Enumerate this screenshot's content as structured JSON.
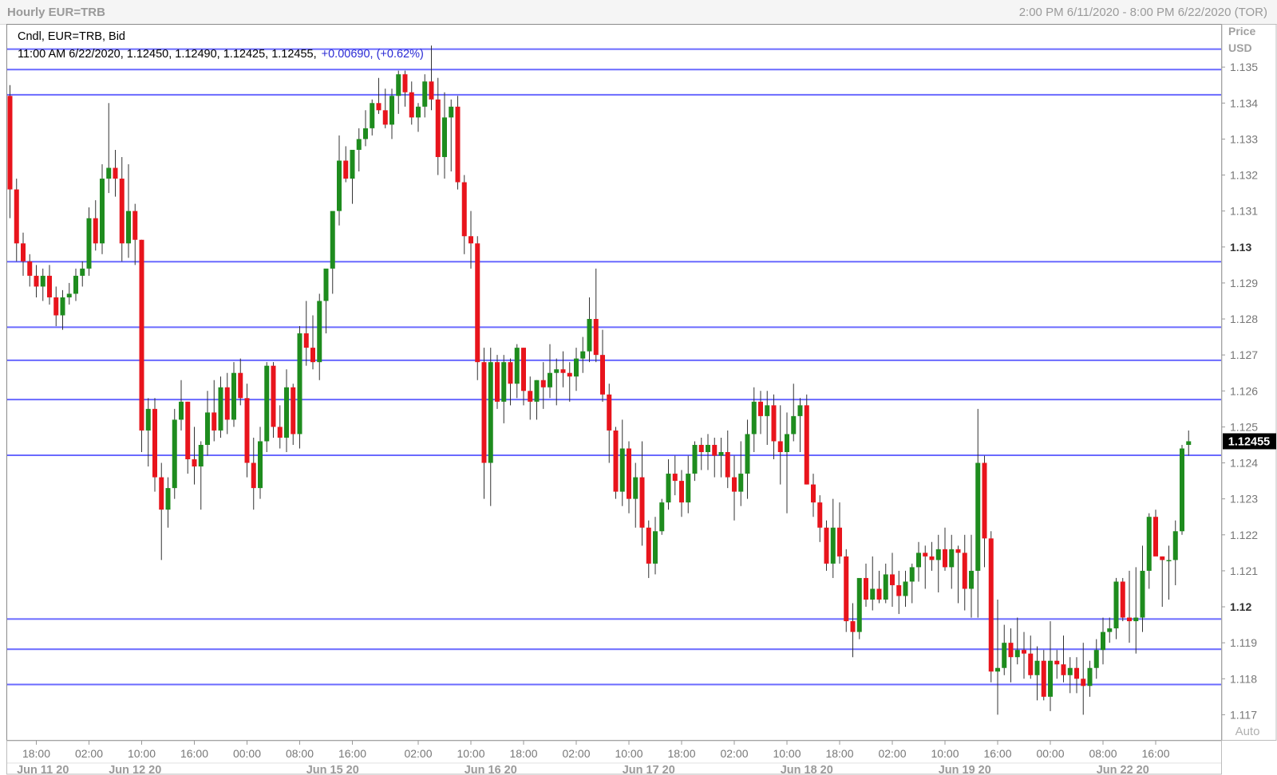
{
  "window": {
    "title": "Hourly EUR=TRB",
    "range": "2:00 PM 6/11/2020 - 8:00 PM 6/22/2020 (TOR)"
  },
  "legend": {
    "line1": "Cndl, EUR=TRB, Bid",
    "ohlc": "11:00 AM 6/22/2020, 1.12450, 1.12490, 1.12425, 1.12455,",
    "change": "+0.00690, (+0.62%)"
  },
  "price_axis": {
    "title_line1": "Price",
    "title_line2": "USD",
    "last_price_label": "1.12455",
    "auto_label": "Auto"
  },
  "colors": {
    "up": "#1e8c1e",
    "down": "#e8141c",
    "hline": "#6a6aff",
    "change_text": "#2b2bd4",
    "last_price_bg": "#000000"
  },
  "chart_data": {
    "type": "candlestick",
    "symbol": "EUR=TRB",
    "interval": "Hourly",
    "ylim": [
      1.1163,
      1.1362
    ],
    "y_ticks": [
      {
        "v": 1.135,
        "label": "1.135"
      },
      {
        "v": 1.134,
        "label": "1.134"
      },
      {
        "v": 1.133,
        "label": "1.133"
      },
      {
        "v": 1.132,
        "label": "1.132"
      },
      {
        "v": 1.131,
        "label": "1.131"
      },
      {
        "v": 1.13,
        "label": "1.13",
        "bold": true
      },
      {
        "v": 1.129,
        "label": "1.129"
      },
      {
        "v": 1.128,
        "label": "1.128"
      },
      {
        "v": 1.127,
        "label": "1.127"
      },
      {
        "v": 1.126,
        "label": "1.126"
      },
      {
        "v": 1.125,
        "label": "1.125"
      },
      {
        "v": 1.124,
        "label": "1.124"
      },
      {
        "v": 1.123,
        "label": "1.123"
      },
      {
        "v": 1.122,
        "label": "1.122"
      },
      {
        "v": 1.121,
        "label": "1.121"
      },
      {
        "v": 1.12,
        "label": "1.12",
        "bold": true
      },
      {
        "v": 1.119,
        "label": "1.119"
      },
      {
        "v": 1.118,
        "label": "1.118"
      },
      {
        "v": 1.117,
        "label": "1.117"
      }
    ],
    "x_ticks": [
      {
        "i": 4,
        "label": "18:00"
      },
      {
        "i": 12,
        "label": "02:00"
      },
      {
        "i": 20,
        "label": "10:00"
      },
      {
        "i": 28,
        "label": "16:00"
      },
      {
        "i": 36,
        "label": "00:00"
      },
      {
        "i": 44,
        "label": "08:00"
      },
      {
        "i": 52,
        "label": "16:00"
      },
      {
        "i": 62,
        "label": "02:00"
      },
      {
        "i": 70,
        "label": "10:00"
      },
      {
        "i": 78,
        "label": "18:00"
      },
      {
        "i": 86,
        "label": "02:00"
      },
      {
        "i": 94,
        "label": "10:00"
      },
      {
        "i": 102,
        "label": "18:00"
      },
      {
        "i": 110,
        "label": "02:00"
      },
      {
        "i": 118,
        "label": "10:00"
      },
      {
        "i": 126,
        "label": "18:00"
      },
      {
        "i": 134,
        "label": "02:00"
      },
      {
        "i": 142,
        "label": "10:00"
      },
      {
        "i": 150,
        "label": "16:00"
      },
      {
        "i": 158,
        "label": "00:00"
      },
      {
        "i": 166,
        "label": "08:00"
      },
      {
        "i": 174,
        "label": "16:00"
      }
    ],
    "date_labels": [
      {
        "i": 5,
        "label": "Jun 11 20"
      },
      {
        "i": 19,
        "label": "Jun 12 20"
      },
      {
        "i": 49,
        "label": "Jun 15 20"
      },
      {
        "i": 73,
        "label": "Jun 16 20"
      },
      {
        "i": 97,
        "label": "Jun 17 20"
      },
      {
        "i": 121,
        "label": "Jun 18 20"
      },
      {
        "i": 145,
        "label": "Jun 19 20"
      },
      {
        "i": 169,
        "label": "Jun 22 20"
      }
    ],
    "hlines": [
      1.1355,
      1.13493,
      1.13423,
      1.12959,
      1.12777,
      1.12685,
      1.12576,
      1.12421,
      1.11966,
      1.11882,
      1.11784
    ],
    "candles": [
      [
        1.1342,
        1.1345,
        1.1308,
        1.1316
      ],
      [
        1.1316,
        1.1319,
        1.1296,
        1.1301
      ],
      [
        1.1301,
        1.1304,
        1.1292,
        1.1296
      ],
      [
        1.1296,
        1.1298,
        1.1289,
        1.1292
      ],
      [
        1.1292,
        1.1295,
        1.1286,
        1.1289
      ],
      [
        1.1289,
        1.1294,
        1.1285,
        1.1292
      ],
      [
        1.1292,
        1.1295,
        1.1284,
        1.1286
      ],
      [
        1.1286,
        1.1289,
        1.1278,
        1.1281
      ],
      [
        1.1281,
        1.1288,
        1.1277,
        1.1286
      ],
      [
        1.1286,
        1.129,
        1.1284,
        1.1287
      ],
      [
        1.1287,
        1.1294,
        1.1285,
        1.1292
      ],
      [
        1.1292,
        1.1296,
        1.1289,
        1.1294
      ],
      [
        1.1294,
        1.1311,
        1.1292,
        1.1308
      ],
      [
        1.1308,
        1.1313,
        1.1299,
        1.1301
      ],
      [
        1.1301,
        1.1323,
        1.1298,
        1.1319
      ],
      [
        1.1319,
        1.134,
        1.1315,
        1.1322
      ],
      [
        1.1322,
        1.1327,
        1.1314,
        1.1319
      ],
      [
        1.1319,
        1.1325,
        1.1296,
        1.1301
      ],
      [
        1.1301,
        1.1323,
        1.1297,
        1.131
      ],
      [
        1.131,
        1.1312,
        1.1295,
        1.1302
      ],
      [
        1.1302,
        1.1302,
        1.1243,
        1.1249
      ],
      [
        1.1249,
        1.1258,
        1.1239,
        1.1255
      ],
      [
        1.1255,
        1.1258,
        1.1232,
        1.1236
      ],
      [
        1.1236,
        1.124,
        1.1213,
        1.1227
      ],
      [
        1.1227,
        1.1236,
        1.1222,
        1.1233
      ],
      [
        1.1233,
        1.1255,
        1.123,
        1.1252
      ],
      [
        1.1252,
        1.1263,
        1.1249,
        1.1257
      ],
      [
        1.1257,
        1.1257,
        1.1237,
        1.1241
      ],
      [
        1.1241,
        1.125,
        1.1234,
        1.1239
      ],
      [
        1.1239,
        1.1246,
        1.1227,
        1.1245
      ],
      [
        1.1245,
        1.126,
        1.1242,
        1.1254
      ],
      [
        1.1254,
        1.1263,
        1.1246,
        1.1249
      ],
      [
        1.1249,
        1.1264,
        1.1247,
        1.1261
      ],
      [
        1.1261,
        1.1265,
        1.1248,
        1.1252
      ],
      [
        1.1252,
        1.1268,
        1.125,
        1.1265
      ],
      [
        1.1265,
        1.1269,
        1.1256,
        1.1258
      ],
      [
        1.1258,
        1.1262,
        1.1236,
        1.124
      ],
      [
        1.124,
        1.1247,
        1.1227,
        1.1233
      ],
      [
        1.1233,
        1.125,
        1.123,
        1.1246
      ],
      [
        1.1246,
        1.1268,
        1.1243,
        1.1267
      ],
      [
        1.1267,
        1.1268,
        1.1247,
        1.125
      ],
      [
        1.125,
        1.1256,
        1.1244,
        1.1247
      ],
      [
        1.1247,
        1.1266,
        1.1243,
        1.1261
      ],
      [
        1.1261,
        1.1262,
        1.1245,
        1.1248
      ],
      [
        1.1248,
        1.1278,
        1.1244,
        1.1276
      ],
      [
        1.1276,
        1.1285,
        1.1267,
        1.1272
      ],
      [
        1.1272,
        1.1281,
        1.1266,
        1.1268
      ],
      [
        1.1268,
        1.1287,
        1.1263,
        1.1285
      ],
      [
        1.1285,
        1.1293,
        1.1276,
        1.1294
      ],
      [
        1.1294,
        1.1301,
        1.1287,
        1.131
      ],
      [
        1.131,
        1.1331,
        1.1306,
        1.1324
      ],
      [
        1.1324,
        1.1328,
        1.1318,
        1.1319
      ],
      [
        1.1319,
        1.1327,
        1.1312,
        1.1327
      ],
      [
        1.1327,
        1.1333,
        1.1321,
        1.133
      ],
      [
        1.133,
        1.1338,
        1.1328,
        1.1333
      ],
      [
        1.1333,
        1.1341,
        1.1331,
        1.134
      ],
      [
        1.134,
        1.1347,
        1.1337,
        1.1338
      ],
      [
        1.1338,
        1.1344,
        1.1333,
        1.1334
      ],
      [
        1.1334,
        1.1344,
        1.133,
        1.1342
      ],
      [
        1.1342,
        1.1349,
        1.1337,
        1.1348
      ],
      [
        1.1348,
        1.1349,
        1.1339,
        1.1343
      ],
      [
        1.1343,
        1.1346,
        1.1334,
        1.1336
      ],
      [
        1.1336,
        1.134,
        1.1332,
        1.1339
      ],
      [
        1.1339,
        1.1348,
        1.1336,
        1.1346
      ],
      [
        1.1346,
        1.1356,
        1.1338,
        1.1341
      ],
      [
        1.1341,
        1.1347,
        1.132,
        1.1325
      ],
      [
        1.1325,
        1.1343,
        1.1319,
        1.1336
      ],
      [
        1.1336,
        1.1341,
        1.1321,
        1.1339
      ],
      [
        1.1339,
        1.1342,
        1.1316,
        1.1318
      ],
      [
        1.1318,
        1.132,
        1.1298,
        1.1303
      ],
      [
        1.1303,
        1.131,
        1.1294,
        1.1301
      ],
      [
        1.1301,
        1.1303,
        1.1263,
        1.1268
      ],
      [
        1.1268,
        1.1272,
        1.123,
        1.124
      ],
      [
        1.124,
        1.1272,
        1.1228,
        1.1268
      ],
      [
        1.1268,
        1.127,
        1.1255,
        1.1257
      ],
      [
        1.1257,
        1.127,
        1.1251,
        1.1268
      ],
      [
        1.1268,
        1.1269,
        1.1256,
        1.1262
      ],
      [
        1.1262,
        1.1273,
        1.1258,
        1.1272
      ],
      [
        1.1272,
        1.1272,
        1.1256,
        1.126
      ],
      [
        1.126,
        1.1264,
        1.1252,
        1.1257
      ],
      [
        1.1257,
        1.1263,
        1.1252,
        1.1263
      ],
      [
        1.1263,
        1.1268,
        1.1255,
        1.1261
      ],
      [
        1.1261,
        1.1273,
        1.1258,
        1.1265
      ],
      [
        1.1265,
        1.1269,
        1.1256,
        1.1266
      ],
      [
        1.1266,
        1.1271,
        1.1261,
        1.1265
      ],
      [
        1.1265,
        1.1268,
        1.1257,
        1.1264
      ],
      [
        1.1264,
        1.1272,
        1.126,
        1.1269
      ],
      [
        1.1269,
        1.1275,
        1.1265,
        1.1271
      ],
      [
        1.1271,
        1.1286,
        1.1268,
        1.128
      ],
      [
        1.128,
        1.1294,
        1.1268,
        1.127
      ],
      [
        1.127,
        1.1277,
        1.1257,
        1.1259
      ],
      [
        1.1259,
        1.1262,
        1.124,
        1.1249
      ],
      [
        1.1249,
        1.125,
        1.123,
        1.1232
      ],
      [
        1.1232,
        1.1252,
        1.1228,
        1.1244
      ],
      [
        1.1244,
        1.1246,
        1.1226,
        1.123
      ],
      [
        1.123,
        1.124,
        1.1222,
        1.1236
      ],
      [
        1.1236,
        1.1246,
        1.1217,
        1.1222
      ],
      [
        1.1222,
        1.1224,
        1.1208,
        1.1212
      ],
      [
        1.1212,
        1.1225,
        1.1209,
        1.1221
      ],
      [
        1.1221,
        1.123,
        1.122,
        1.1229
      ],
      [
        1.1229,
        1.1241,
        1.1227,
        1.1237
      ],
      [
        1.1237,
        1.1242,
        1.1231,
        1.1235
      ],
      [
        1.1235,
        1.1238,
        1.1225,
        1.1229
      ],
      [
        1.1229,
        1.1242,
        1.1226,
        1.1237
      ],
      [
        1.1237,
        1.1246,
        1.1235,
        1.1245
      ],
      [
        1.1245,
        1.1247,
        1.1238,
        1.1243
      ],
      [
        1.1243,
        1.1248,
        1.1238,
        1.1245
      ],
      [
        1.1245,
        1.1247,
        1.1236,
        1.1242
      ],
      [
        1.1242,
        1.1247,
        1.1236,
        1.1243
      ],
      [
        1.1243,
        1.1249,
        1.1233,
        1.1236
      ],
      [
        1.1236,
        1.1242,
        1.1224,
        1.1232
      ],
      [
        1.1232,
        1.1246,
        1.1228,
        1.1237
      ],
      [
        1.1237,
        1.1252,
        1.123,
        1.1248
      ],
      [
        1.1248,
        1.1261,
        1.1243,
        1.1257
      ],
      [
        1.1257,
        1.126,
        1.1248,
        1.1253
      ],
      [
        1.1253,
        1.126,
        1.1245,
        1.1256
      ],
      [
        1.1256,
        1.1259,
        1.1241,
        1.1246
      ],
      [
        1.1246,
        1.1256,
        1.1234,
        1.1243
      ],
      [
        1.1243,
        1.1254,
        1.1226,
        1.1248
      ],
      [
        1.1248,
        1.1262,
        1.1246,
        1.1253
      ],
      [
        1.1253,
        1.1258,
        1.1243,
        1.1256
      ],
      [
        1.1256,
        1.1259,
        1.1234,
        1.1234
      ],
      [
        1.1234,
        1.1237,
        1.1225,
        1.1229
      ],
      [
        1.1229,
        1.1231,
        1.1218,
        1.1222
      ],
      [
        1.1222,
        1.1224,
        1.121,
        1.1212
      ],
      [
        1.1212,
        1.123,
        1.1208,
        1.1222
      ],
      [
        1.1222,
        1.1229,
        1.1212,
        1.1214
      ],
      [
        1.1214,
        1.1216,
        1.1193,
        1.1196
      ],
      [
        1.1196,
        1.1201,
        1.1186,
        1.1193
      ],
      [
        1.1193,
        1.1205,
        1.1191,
        1.1208
      ],
      [
        1.1208,
        1.1212,
        1.12,
        1.1202
      ],
      [
        1.1202,
        1.1214,
        1.1199,
        1.1205
      ],
      [
        1.1205,
        1.121,
        1.1201,
        1.1202
      ],
      [
        1.1202,
        1.1212,
        1.1201,
        1.1209
      ],
      [
        1.1209,
        1.1215,
        1.12,
        1.1206
      ],
      [
        1.1206,
        1.121,
        1.1198,
        1.1203
      ],
      [
        1.1203,
        1.121,
        1.12,
        1.1207
      ],
      [
        1.1207,
        1.1212,
        1.1201,
        1.1211
      ],
      [
        1.1211,
        1.1218,
        1.1207,
        1.1215
      ],
      [
        1.1215,
        1.1217,
        1.1205,
        1.1214
      ],
      [
        1.1214,
        1.1218,
        1.121,
        1.1213
      ],
      [
        1.1213,
        1.122,
        1.1204,
        1.1216
      ],
      [
        1.1216,
        1.1222,
        1.121,
        1.1211
      ],
      [
        1.1211,
        1.122,
        1.1205,
        1.1216
      ],
      [
        1.1216,
        1.1217,
        1.1201,
        1.1215
      ],
      [
        1.1215,
        1.122,
        1.1199,
        1.1205
      ],
      [
        1.1205,
        1.122,
        1.1197,
        1.121
      ],
      [
        1.121,
        1.1255,
        1.1197,
        1.124
      ],
      [
        1.124,
        1.1242,
        1.1211,
        1.1219
      ],
      [
        1.1219,
        1.1221,
        1.1179,
        1.1182
      ],
      [
        1.1182,
        1.1202,
        1.117,
        1.1183
      ],
      [
        1.1183,
        1.1195,
        1.1181,
        1.119
      ],
      [
        1.119,
        1.1194,
        1.1179,
        1.1186
      ],
      [
        1.1186,
        1.1197,
        1.1184,
        1.1188
      ],
      [
        1.1188,
        1.1193,
        1.118,
        1.1187
      ],
      [
        1.1187,
        1.1192,
        1.118,
        1.1181
      ],
      [
        1.1181,
        1.1189,
        1.1174,
        1.1185
      ],
      [
        1.1185,
        1.1188,
        1.1174,
        1.1175
      ],
      [
        1.1175,
        1.1196,
        1.1171,
        1.1185
      ],
      [
        1.1185,
        1.1188,
        1.118,
        1.1184
      ],
      [
        1.1184,
        1.1192,
        1.1179,
        1.1181
      ],
      [
        1.1181,
        1.1186,
        1.1176,
        1.1183
      ],
      [
        1.1183,
        1.1186,
        1.1176,
        1.118
      ],
      [
        1.118,
        1.119,
        1.117,
        1.1178
      ],
      [
        1.1178,
        1.1185,
        1.1175,
        1.1183
      ],
      [
        1.1183,
        1.1191,
        1.118,
        1.1188
      ],
      [
        1.1188,
        1.1197,
        1.1184,
        1.1193
      ],
      [
        1.1193,
        1.1197,
        1.119,
        1.1194
      ],
      [
        1.1194,
        1.1208,
        1.1191,
        1.1207
      ],
      [
        1.1207,
        1.1208,
        1.1196,
        1.1197
      ],
      [
        1.1197,
        1.121,
        1.119,
        1.1196
      ],
      [
        1.1196,
        1.1211,
        1.1187,
        1.1197
      ],
      [
        1.1197,
        1.1217,
        1.1193,
        1.121
      ],
      [
        1.121,
        1.1226,
        1.1205,
        1.1225
      ],
      [
        1.1225,
        1.1227,
        1.1215,
        1.1214
      ],
      [
        1.1214,
        1.1214,
        1.12,
        1.1213
      ],
      [
        1.1213,
        1.1217,
        1.1202,
        1.1213
      ],
      [
        1.1213,
        1.1224,
        1.1206,
        1.1221
      ],
      [
        1.1221,
        1.1245,
        1.122,
        1.1244
      ],
      [
        1.1245,
        1.1249,
        1.1242,
        1.1246
      ]
    ]
  }
}
